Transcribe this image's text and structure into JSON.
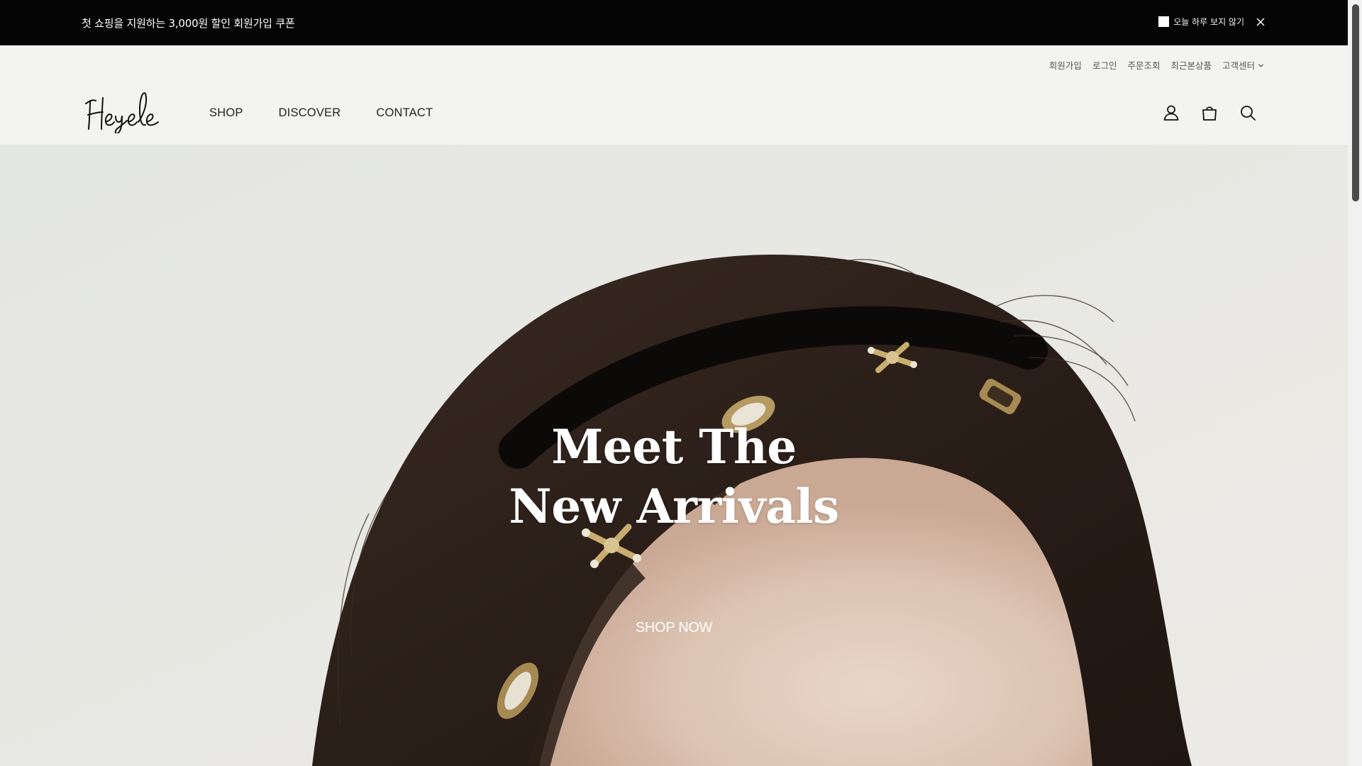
{
  "promo": {
    "text": "첫 쇼핑을 지원하는 3,000원 할인 회원가입 쿠폰",
    "hide_today_label": "오늘 하루 보지 않기",
    "hide_today_checked": false
  },
  "util_nav": {
    "signup": "회원가입",
    "login": "로그인",
    "order_lookup": "주문조회",
    "recent_viewed": "최근본상품",
    "customer_center": "고객센터"
  },
  "brand": {
    "logo_text": "Heyele"
  },
  "main_nav": {
    "shop": "SHOP",
    "discover": "DISCOVER",
    "contact": "CONTACT"
  },
  "header_icons": [
    "user-icon",
    "shopping-bag-icon",
    "search-icon"
  ],
  "hero": {
    "title_line1": "Meet The",
    "title_line2": "New Arrivals",
    "cta": "SHOP NOW"
  },
  "colors": {
    "promo_bg": "#050505",
    "header_bg": "#f3f3f2",
    "hero_bg": "#e7e8e4",
    "hair": "#2a1f1a",
    "text_light": "#ffffff"
  }
}
